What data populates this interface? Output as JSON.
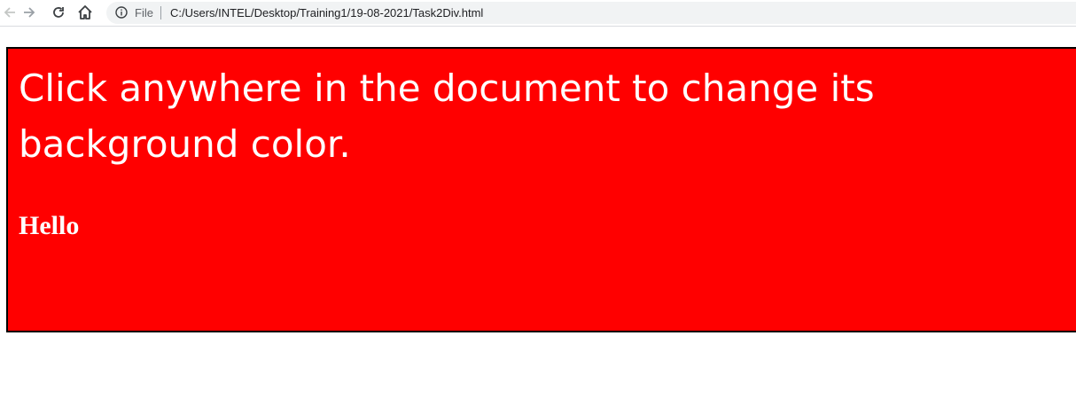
{
  "browser": {
    "back_icon": "arrow-left-icon",
    "forward_icon": "arrow-right-icon",
    "reload_icon": "reload-icon",
    "home_icon": "home-icon",
    "info_icon": "info-icon",
    "scheme_label": "File",
    "url": "C:/Users/INTEL/Desktop/Training1/19-08-2021/Task2Div.html"
  },
  "page": {
    "background_color": "#ff0000",
    "text_color": "#ffffff",
    "border_color": "#000000",
    "instruction": "Click anywhere in the document to change its background color.",
    "hello": "Hello"
  }
}
